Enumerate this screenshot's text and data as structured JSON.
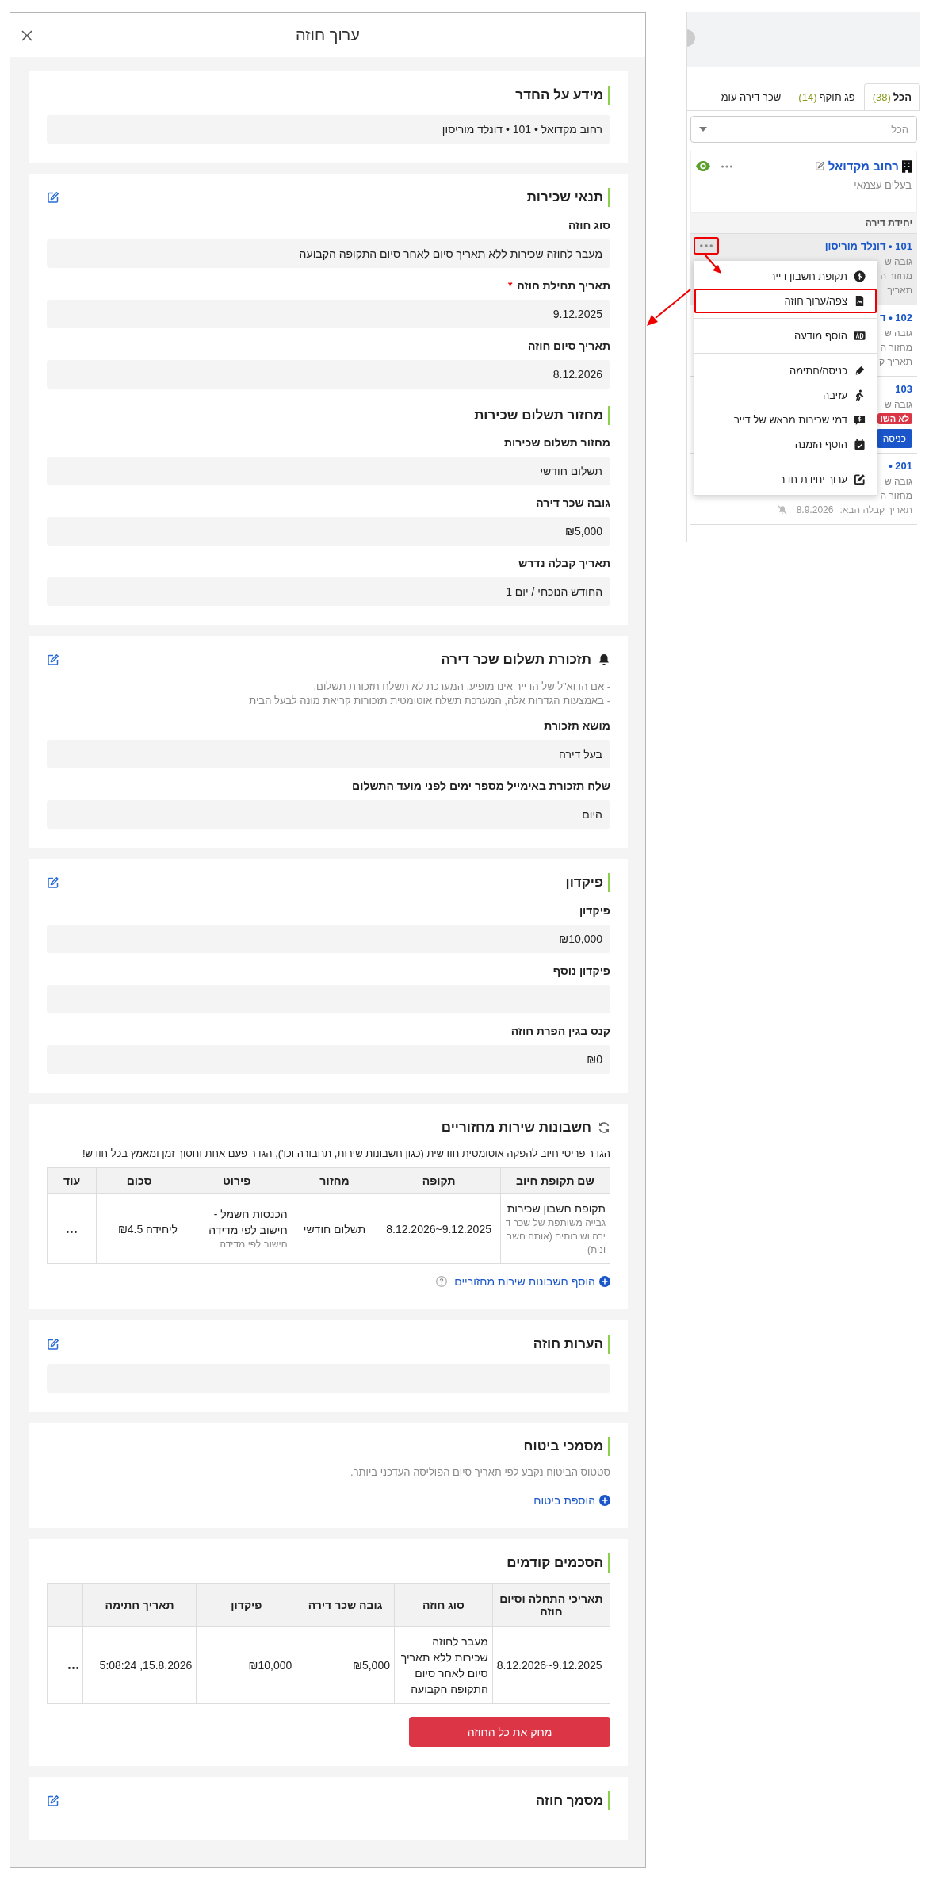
{
  "modal": {
    "title": "ערוך חוזה"
  },
  "sections": [
    {
      "kind": "plain",
      "title": "מידע על החדר",
      "editable": false,
      "value": "רחוב מקדואל • 101 • דונלד מוריסון"
    },
    {
      "kind": "plain",
      "title": "תנאי שכירות",
      "editable": true,
      "items": [
        {
          "kind": "field",
          "label": "סוג חוזה",
          "value": "מעבר לחוזה שכירות ללא תאריך סיום לאחר סיום התקופה הקבועה"
        },
        {
          "kind": "field",
          "label": "תאריך תחילת חוזה",
          "required_mark": "*",
          "value": "9.12.2025"
        },
        {
          "kind": "field",
          "label": "תאריך סיום חוזה",
          "value": "8.12.2026"
        },
        {
          "kind": "heading",
          "label": "מחזור תשלום שכירות"
        },
        {
          "kind": "field",
          "label": "מחזור תשלום שכירות",
          "value": "תשלום חודשי"
        },
        {
          "kind": "field",
          "label": "גובה שכר דירה",
          "value": "₪5,000"
        },
        {
          "kind": "field",
          "label": "תאריך קבלה נדרש",
          "value": "החודש הנוכחי / יום 1"
        }
      ]
    },
    {
      "kind": "reminder",
      "title": "תזכורת תשלום שכר דירה",
      "editable": true,
      "notes": [
        "- אם הדוא”ל של הדייר אינו מופיע, המערכת לא תשלח תזכורת תשלום.",
        "- באמצעות הגדרות אלה, המערכת תשלח אוטומטית תזכורות קריאת מונה לבעל הבית"
      ],
      "items": [
        {
          "kind": "field",
          "label": "מושא תזכורת",
          "value": "בעל דירה"
        },
        {
          "kind": "field",
          "label": "שלח תזכורת באימייל מספר ימים לפני מועד התשלום",
          "value": "היום"
        }
      ]
    },
    {
      "kind": "plain",
      "title": "פיקדון",
      "editable": true,
      "items": [
        {
          "kind": "field",
          "label": "פיקדון",
          "value": "₪10,000"
        },
        {
          "kind": "field",
          "label": "פיקדון נוסף"
        },
        {
          "kind": "field",
          "label": "קנס בגין הפרת חוזה",
          "value": "₪0"
        }
      ]
    },
    {
      "kind": "recurring",
      "title": "חשבונות שירות מחזוריים",
      "editable": false,
      "description": "הגדר פריטי חיוב להפקה אוטומטית חודשית (כגון חשבונות שירות, תחבורה וכו'), הגדר פעם אחת וחסוך זמן ומאמץ בכל חודש!",
      "table": {
        "columns": [
          "שם תקופת חיוב",
          "תקופה",
          "מחזור",
          "פירוט",
          "סכום",
          "עוד"
        ],
        "rows": [
          {
            "cells": [
              {
                "text": "תקופת חשבון שכירות",
                "sub": "גבייה משותפת של שכר דירה ושירותים (אותה חשבונית)"
              },
              {
                "text": "8.12.2026~9.12.2025"
              },
              {
                "text": "תשלום חודשי"
              },
              {
                "text": "הכנסות חשמל - חישוב לפי מדידה",
                "sub": "חישוב לפי מדידה"
              },
              {
                "text": "ליחידה ₪4.5"
              }
            ]
          }
        ]
      },
      "add_link": "הוסף חשבונות שירות מחזוריים"
    },
    {
      "kind": "plain",
      "title": "הערות חוזה",
      "editable": true,
      "blank_box": true
    },
    {
      "kind": "plain",
      "title": "מסמכי ביטוח",
      "editable": false,
      "description": "סטטוס הביטוח נקבע לפי תאריך סיום הפוליסה העדכני ביותר.",
      "add_link": "הוספת ביטוח"
    },
    {
      "kind": "plain",
      "title": "הסכמים קודמים",
      "editable": false,
      "history": {
        "columns": [
          "תאריכי התחלה וסיום חוזה",
          "סוג חוזה",
          "גובה שכר דירה",
          "פיקדון",
          "תאריך חתימה"
        ],
        "rows": [
          {
            "cells": [
              "8.12.2026~9.12.2025",
              "מעבר לחוזה שכירות ללא תאריך סיום לאחר סיום התקופה הקבועה",
              "₪5,000",
              "₪10,000",
              "5:08:24 ,15.8.2026"
            ]
          }
        ]
      },
      "delete_button": "מחק את כל החוזה"
    },
    {
      "kind": "plain",
      "title": "מסמך חוזה",
      "editable": true
    }
  ],
  "side_panel": {
    "tabs": [
      {
        "label": "הכל",
        "count": "(38)",
        "selected": true
      },
      {
        "label": "פג תוקף",
        "count": "(14)",
        "selected": false
      },
      {
        "label": "שכר דירה עומ",
        "selected": false
      }
    ],
    "filter": {
      "placeholder": "הכל"
    },
    "property": {
      "name": "רחוב מקדואל",
      "owner": "בעלים עצמאי"
    },
    "units_header": "יחידת דירה",
    "units": [
      {
        "title": "101 • דונלד מוריסון",
        "lines": [
          "גובה ש",
          "מחזור ה",
          "תאריך"
        ],
        "selected": true,
        "more_highlighted": true
      },
      {
        "title": "102 • ד",
        "lines": [
          "גובה ש",
          "מחזור ה",
          "תאריך ק"
        ],
        "selected": false
      },
      {
        "title": "103",
        "lines": [
          "גובה ש"
        ],
        "badge": "לא השו",
        "button": "כניסה",
        "selected": false
      },
      {
        "title": "201 •",
        "lines": [
          "גובה ש",
          "מחזור ה"
        ],
        "next_date_label": "תאריך קבלה הבא:",
        "next_date": "8.9.2026",
        "selected": false
      }
    ],
    "menu": {
      "items": [
        {
          "label": "תקופת חשבון דייר",
          "highlighted": false,
          "divider_after": false
        },
        {
          "label": "צפה/ערוך חוזה",
          "highlighted": true,
          "divider_after": true
        },
        {
          "label": "הוסף מודעה",
          "highlighted": false,
          "divider_after": true
        },
        {
          "label": "כניסה/חתימה",
          "highlighted": false,
          "divider_after": false
        },
        {
          "label": "עזיבה",
          "highlighted": false,
          "divider_after": false
        },
        {
          "label": "דמי שכירות מראש של דייר",
          "highlighted": false,
          "divider_after": false
        },
        {
          "label": "הוסף הזמנה",
          "highlighted": false,
          "divider_after": true
        },
        {
          "label": "ערוך יחידת חדר",
          "highlighted": false,
          "divider_after": false
        }
      ]
    }
  }
}
